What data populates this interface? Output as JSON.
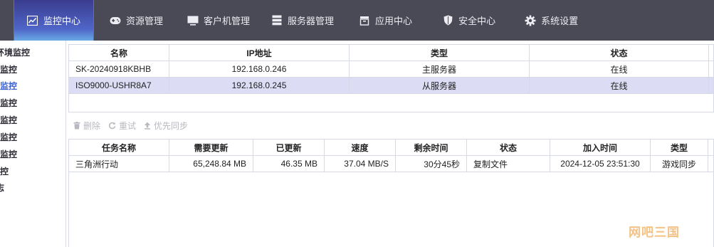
{
  "nav": {
    "tabs": [
      {
        "label": "监控中心",
        "icon": "chart-line-icon",
        "active": true
      },
      {
        "label": "资源管理",
        "icon": "gamepad-icon",
        "active": false
      },
      {
        "label": "客户机管理",
        "icon": "monitor-icon",
        "active": false
      },
      {
        "label": "服务器管理",
        "icon": "server-icon",
        "active": false
      },
      {
        "label": "应用中心",
        "icon": "app-box-icon",
        "active": false
      },
      {
        "label": "安全中心",
        "icon": "shield-icon",
        "active": false
      },
      {
        "label": "系统设置",
        "icon": "gear-icon",
        "active": false
      }
    ]
  },
  "sidebar": {
    "items": [
      {
        "label": "环境监控",
        "active": false
      },
      {
        "label": "监控",
        "active": false
      },
      {
        "label": "监控",
        "active": true
      },
      {
        "label": "监控",
        "active": false
      },
      {
        "label": "监控",
        "active": false
      },
      {
        "label": "监控",
        "active": false
      },
      {
        "label": "监控",
        "active": false
      },
      {
        "label": "监控",
        "active": false
      },
      {
        "label": "志",
        "active": false
      }
    ]
  },
  "servers": {
    "columns": [
      "名称",
      "IP地址",
      "类型",
      "状态"
    ],
    "rows": [
      {
        "name": "SK-20240918KBHB",
        "ip": "192.168.0.246",
        "type": "主服务器",
        "status": "在线",
        "selected": false
      },
      {
        "name": "ISO9000-USHR8A7",
        "ip": "192.168.0.245",
        "type": "从服务器",
        "status": "在线",
        "selected": true
      }
    ]
  },
  "toolbar": {
    "delete_label": "删除",
    "retry_label": "重试",
    "priority_label": "优先同步"
  },
  "tasks": {
    "columns": [
      "任务名称",
      "需要更新",
      "已更新",
      "速度",
      "剩余时间",
      "状态",
      "加入时间",
      "类型"
    ],
    "rows": [
      {
        "name": "三角洲行动",
        "need": "65,248.84 MB",
        "done": "46.35 MB",
        "speed": "37.04 MB/S",
        "remaining": "30分45秒",
        "status": "复制文件",
        "added": "2024-12-05 23:51:30",
        "type": "游戏同步"
      }
    ]
  },
  "watermark": "网吧三国",
  "colors": {
    "nav_bg": "#4a4a57",
    "active_tab_gradient": [
      "#3a3c8e",
      "#69a9e6"
    ],
    "selected_row": "#dcdcf4",
    "sidebar_active": "#3d5fd0",
    "toolbar_disabled": "#b8b8c0",
    "watermark": "#f4b770"
  }
}
